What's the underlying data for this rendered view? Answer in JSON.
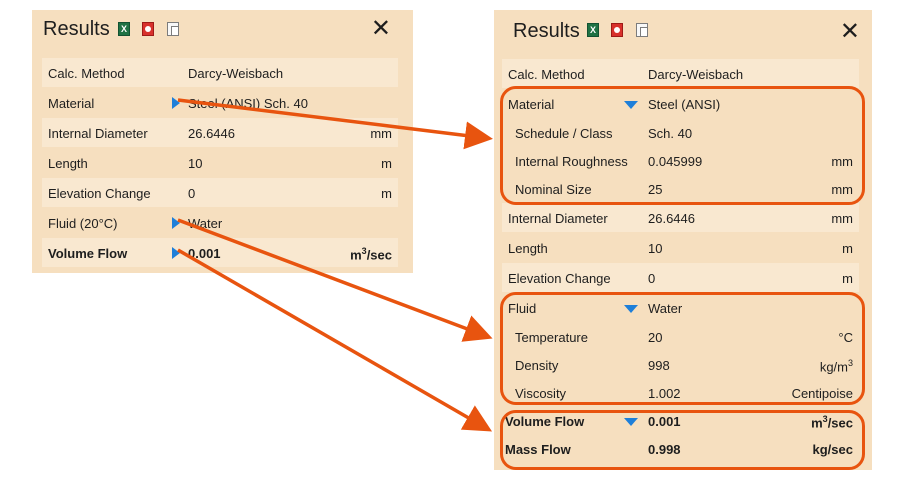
{
  "left_panel": {
    "title": "Results",
    "close": "✕",
    "rows": [
      {
        "label": "Calc. Method",
        "value": "Darcy-Weisbach",
        "unit": ""
      },
      {
        "label": "Material",
        "value": "Steel (ANSI) Sch.  40",
        "unit": ""
      },
      {
        "label": "Internal Diameter",
        "value": "26.6446",
        "unit": "mm"
      },
      {
        "label": "Length",
        "value": "10",
        "unit": "m"
      },
      {
        "label": "Elevation Change",
        "value": "0",
        "unit": "m"
      },
      {
        "label": "Fluid (20°C)",
        "value": "Water",
        "unit": ""
      },
      {
        "label": "Volume Flow",
        "value": "0.001",
        "unit_base": "m",
        "unit_sup": "3",
        "unit_tail": "/sec"
      }
    ]
  },
  "right_panel": {
    "title": "Results",
    "close": "✕",
    "rows": [
      {
        "label": "Calc. Method",
        "value": "Darcy-Weisbach",
        "unit": ""
      },
      {
        "label": "Material",
        "value": "Steel (ANSI)",
        "unit": ""
      },
      {
        "label": "Schedule / Class",
        "value": "Sch.  40",
        "unit": ""
      },
      {
        "label": "Internal Roughness",
        "value": "0.045999",
        "unit": "mm"
      },
      {
        "label": "Nominal Size",
        "value": "25",
        "unit": "mm"
      },
      {
        "label": "Internal Diameter",
        "value": "26.6446",
        "unit": "mm"
      },
      {
        "label": "Length",
        "value": "10",
        "unit": "m"
      },
      {
        "label": "Elevation Change",
        "value": "0",
        "unit": "m"
      },
      {
        "label": "Fluid",
        "value": "Water",
        "unit": ""
      },
      {
        "label": "Temperature",
        "value": "20",
        "unit": "°C"
      },
      {
        "label": "Density",
        "value": "998",
        "unit_base": "kg/m",
        "unit_sup": "3",
        "unit_tail": ""
      },
      {
        "label": "Viscosity",
        "value": "1.002",
        "unit": "Centipoise"
      },
      {
        "label": "Volume Flow",
        "value": "0.001",
        "unit_base": "m",
        "unit_sup": "3",
        "unit_tail": "/sec"
      },
      {
        "label": "Mass Flow",
        "value": "0.998",
        "unit": "kg/sec"
      }
    ]
  },
  "colors": {
    "panel_bg": "#f6dfbf",
    "row_light": "#f9e8d0",
    "highlight": "#e8540f",
    "expander": "#1e7fd9"
  },
  "icons": [
    "excel-export-icon",
    "pdf-export-icon",
    "copy-icon",
    "close-icon",
    "expand-right-icon",
    "collapse-down-icon"
  ]
}
